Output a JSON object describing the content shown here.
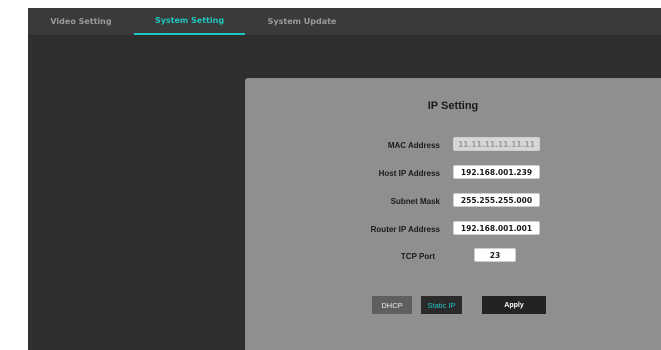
{
  "tabs": [
    {
      "label": "Video Setting"
    },
    {
      "label": "System Setting"
    },
    {
      "label": "System Update"
    }
  ],
  "active_tab": "System Setting",
  "ip_setting": {
    "title": "IP Setting",
    "mac": {
      "label": "MAC Address",
      "value": "11.11.11.11.11.11"
    },
    "host_ip": {
      "label": "Host IP Address",
      "value": "192.168.001.239"
    },
    "subnet": {
      "label": "Subnet Mask",
      "value": "255.255.255.000"
    },
    "router_ip": {
      "label": "Router IP Address",
      "value": "192.168.001.001"
    },
    "tcp_port": {
      "label": "TCP Port",
      "value": "23"
    }
  },
  "buttons": {
    "dhcp": "DHCP",
    "static_ip": "Static IP",
    "apply": "Apply"
  },
  "colors": {
    "accent": "#1fc7c0",
    "background": "#2f2f2f",
    "panel": "#8f8f8f"
  }
}
